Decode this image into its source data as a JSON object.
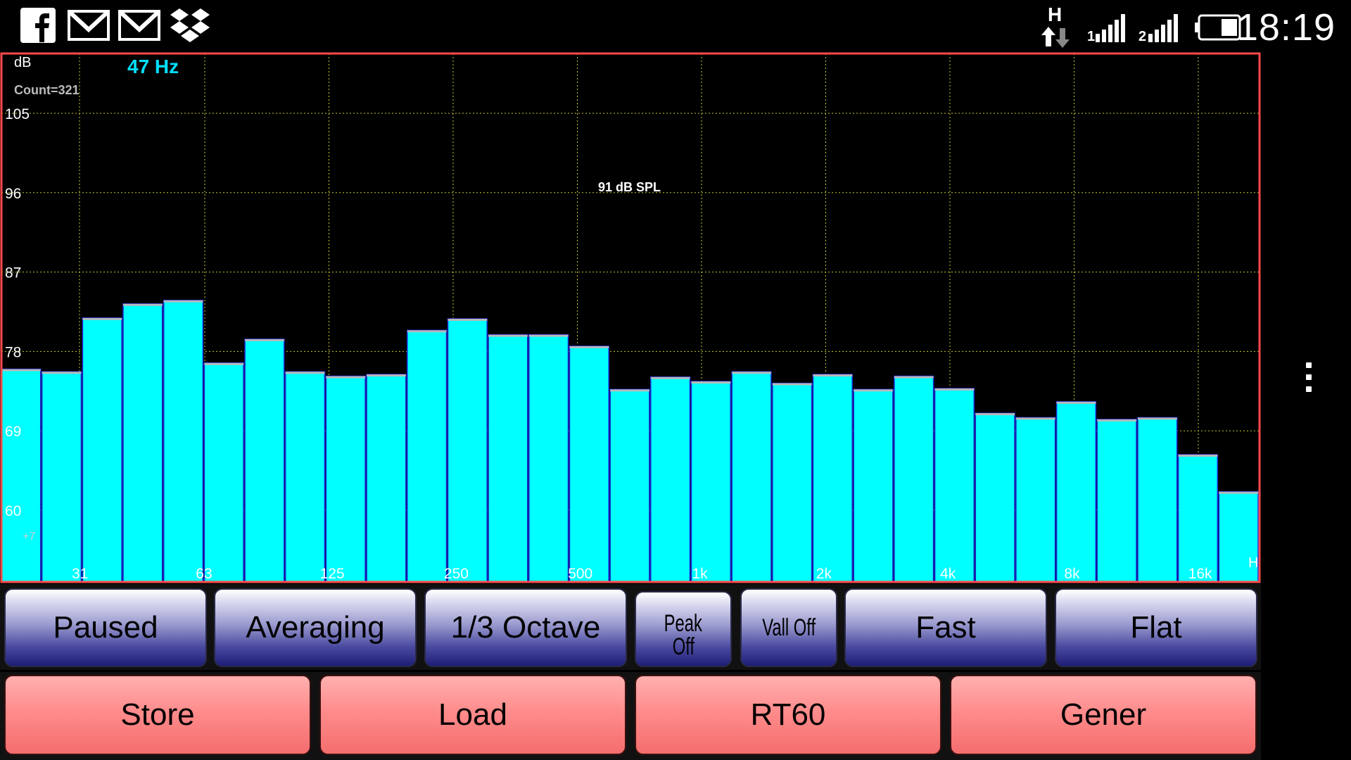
{
  "status_bar": {
    "icons": [
      "facebook-icon",
      "gmail-icon",
      "gmail-icon",
      "dropbox-icon"
    ],
    "network_type": "H",
    "time": "18:19"
  },
  "chart": {
    "units": "dB",
    "cursor_freq": "47 Hz",
    "count": "Count=321",
    "spl": "91 dB SPL",
    "offset": "+7",
    "hz_marker": "H",
    "y_ticks": [
      "105",
      "96",
      "87",
      "78",
      "69",
      "60"
    ],
    "x_ticks": [
      "31",
      "63",
      "125",
      "250",
      "500",
      "1k",
      "2k",
      "4k",
      "8k",
      "16k"
    ]
  },
  "chart_data": {
    "type": "bar",
    "title": "",
    "ylabel": "dB",
    "ylim": [
      53,
      112
    ],
    "y_ticks": [
      105,
      96,
      87,
      78,
      69,
      60
    ],
    "x_ticks": [
      "31",
      "63",
      "125",
      "250",
      "500",
      "1k",
      "2k",
      "4k",
      "8k",
      "16k"
    ],
    "values": [
      76.0,
      75.7,
      81.8,
      83.4,
      83.8,
      76.7,
      79.4,
      75.7,
      75.2,
      75.4,
      80.4,
      81.7,
      79.9,
      79.9,
      78.6,
      73.7,
      75.1,
      74.6,
      75.7,
      74.4,
      75.4,
      73.7,
      75.2,
      73.8,
      71.0,
      70.5,
      72.3,
      70.3,
      70.5,
      66.3,
      62.1
    ],
    "grid": true,
    "series_color": "#00ffff"
  },
  "toolbar_top": {
    "paused": "Paused",
    "averaging": "Averaging",
    "octave": "1/3 Octave",
    "peak": "Peak",
    "peak_sub": "Off",
    "valley": "Vall Off",
    "fast": "Fast",
    "flat": "Flat"
  },
  "toolbar_bottom": {
    "store": "Store",
    "load": "Load",
    "rt60": "RT60",
    "gener": "Gener"
  }
}
